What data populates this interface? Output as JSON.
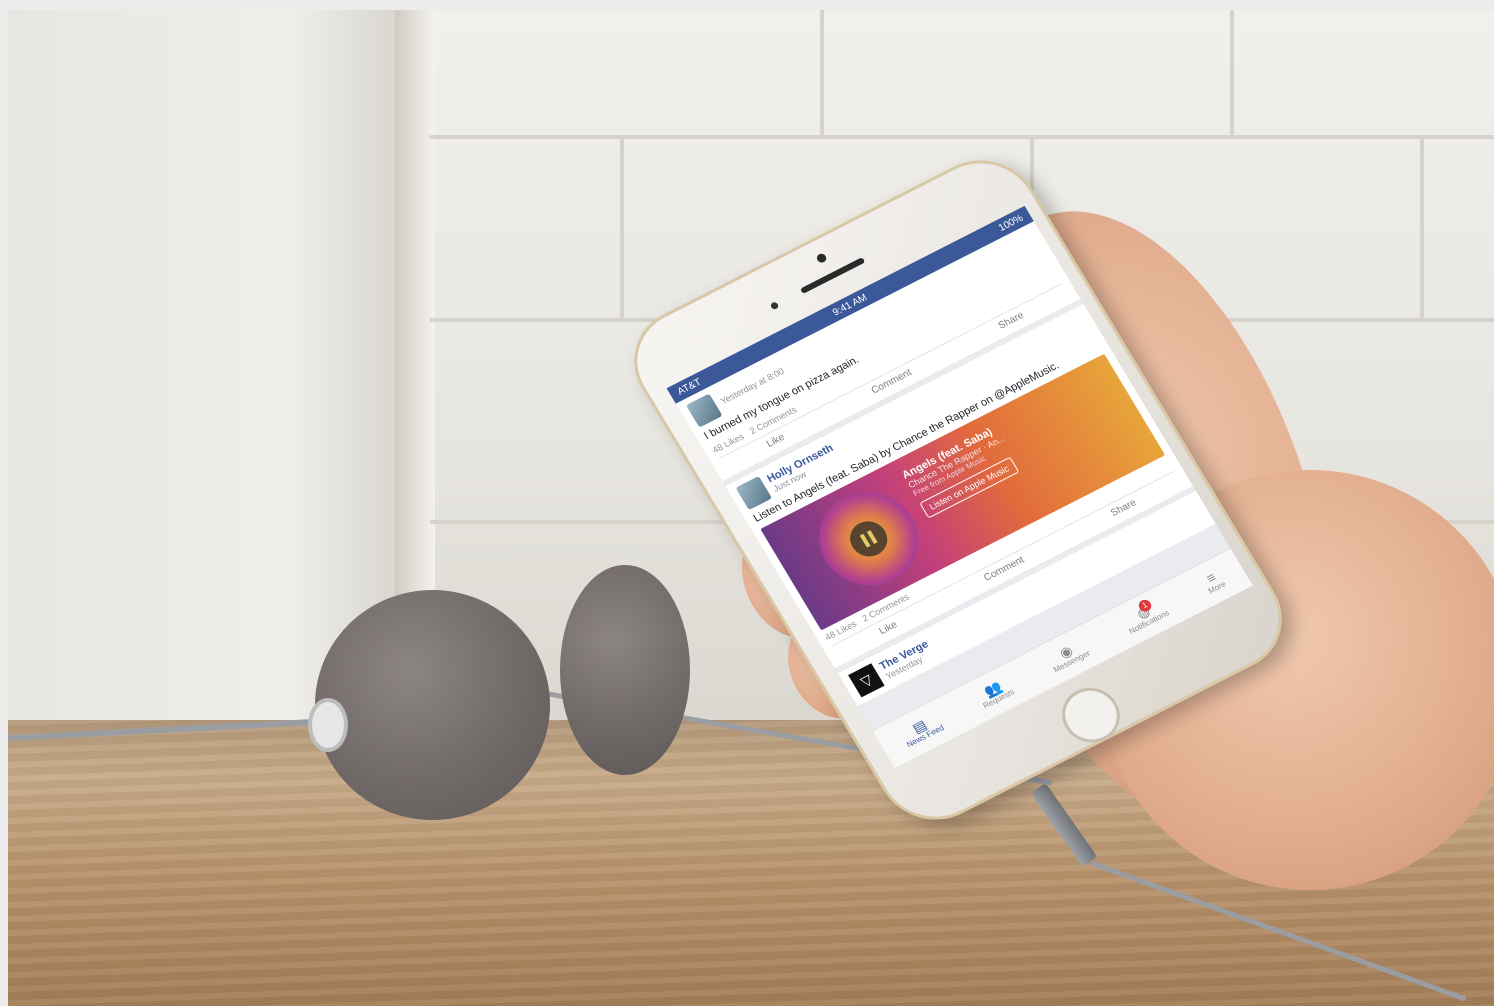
{
  "phone": {
    "status": {
      "carrier": "AT&T",
      "time": "9:41 AM",
      "battery": "100%"
    },
    "feed": [
      {
        "author": "",
        "time": "Yesterday at 8:00",
        "text": "I burned my tongue on pizza again.",
        "likes": "48 Likes",
        "comments": "2 Comments",
        "actions": {
          "like": "Like",
          "comment": "Comment",
          "share": "Share"
        }
      },
      {
        "author": "Holly Ornseth",
        "time": "Just now",
        "text": "Listen to Angels (feat. Saba) by Chance the Rapper on @AppleMusic.",
        "music": {
          "title": "Angels (feat. Saba)",
          "artist": "Chance The Rapper · An...",
          "source": "Free from Apple Music",
          "button": "Listen on Apple Music"
        },
        "likes": "48 Likes",
        "comments": "2 Comments",
        "actions": {
          "like": "Like",
          "comment": "Comment",
          "share": "Share"
        }
      },
      {
        "author": "The Verge",
        "time": "Yesterday"
      }
    ],
    "tabbar": {
      "items": [
        {
          "label": "News Feed",
          "icon": "news-feed-icon"
        },
        {
          "label": "Requests",
          "icon": "friend-requests-icon"
        },
        {
          "label": "Messenger",
          "icon": "messenger-icon"
        },
        {
          "label": "Notifications",
          "icon": "globe-icon",
          "badge": "1"
        },
        {
          "label": "More",
          "icon": "menu-icon"
        }
      ]
    }
  },
  "colors": {
    "facebook_blue": "#3b5998",
    "notification_red": "#e0393e",
    "headphone_gray": "#736c6a",
    "table_wood": "#b8936c"
  }
}
